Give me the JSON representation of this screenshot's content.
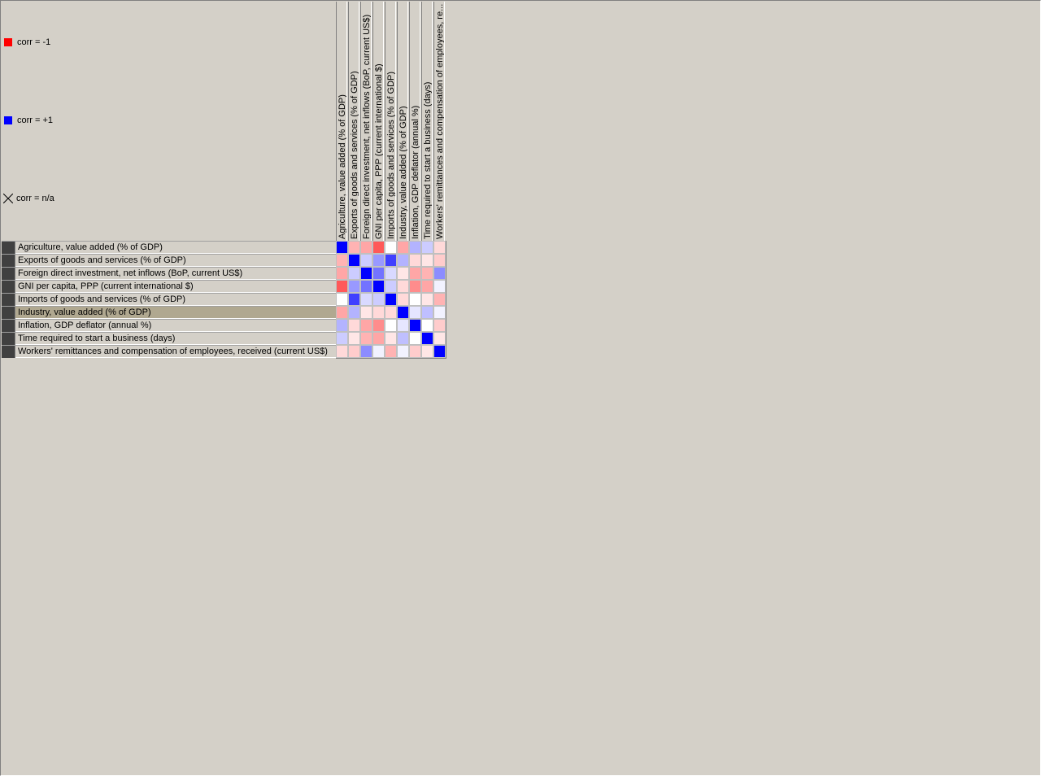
{
  "legend": [
    {
      "label": "corr = -1",
      "color": "#ff0000",
      "icon": "red-square-icon"
    },
    {
      "label": "corr = +1",
      "color": "#0000ff",
      "icon": "blue-square-icon"
    },
    {
      "label": "corr = n/a",
      "icon": "cross-icon"
    }
  ],
  "variables": [
    "Agriculture, value added (% of GDP)",
    "Exports of goods and services (% of GDP)",
    "Foreign direct investment, net inflows (BoP, current US$)",
    "GNI per capita, PPP (current international $)",
    "Imports of goods and services (% of GDP)",
    "Industry, value added (% of GDP)",
    "Inflation, GDP deflator (annual %)",
    "Time required to start a business (days)",
    "Workers' remittances and compensation of employees, received (current US$)"
  ],
  "column_headers": [
    "Agriculture, value added (% of GDP)",
    "Exports of goods and services (% of GDP)",
    "Foreign direct investment, net inflows (BoP, current US$)",
    "GNI per capita, PPP (current international $)",
    "Imports of goods and services (% of GDP)",
    "Industry, value added (% of GDP)",
    "Inflation, GDP deflator (annual %)",
    "Time required to start a business (days)",
    "Workers' remittances and compensation of employees, re..."
  ],
  "selected_row": 5,
  "colors": {
    "negative": "#ff0000",
    "positive": "#0000ff",
    "neutral": "#ffffff"
  },
  "chart_data": {
    "type": "heatmap",
    "x": [
      "Agriculture, value added (% of GDP)",
      "Exports of goods and services (% of GDP)",
      "Foreign direct investment, net inflows (BoP, current US$)",
      "GNI per capita, PPP (current international $)",
      "Imports of goods and services (% of GDP)",
      "Industry, value added (% of GDP)",
      "Inflation, GDP deflator (annual %)",
      "Time required to start a business (days)",
      "Workers' remittances and compensation of employees, received (current US$)"
    ],
    "y": [
      "Agriculture, value added (% of GDP)",
      "Exports of goods and services (% of GDP)",
      "Foreign direct investment, net inflows (BoP, current US$)",
      "GNI per capita, PPP (current international $)",
      "Imports of goods and services (% of GDP)",
      "Industry, value added (% of GDP)",
      "Inflation, GDP deflator (annual %)",
      "Time required to start a business (days)",
      "Workers' remittances and compensation of employees, received (current US$)"
    ],
    "values": [
      [
        1.0,
        -0.3,
        -0.35,
        -0.65,
        0.0,
        -0.35,
        0.3,
        0.2,
        -0.15
      ],
      [
        -0.3,
        1.0,
        0.2,
        0.4,
        0.75,
        0.3,
        -0.15,
        -0.1,
        -0.2
      ],
      [
        -0.35,
        0.2,
        1.0,
        0.55,
        0.15,
        -0.1,
        -0.35,
        -0.3,
        0.45
      ],
      [
        -0.65,
        0.4,
        0.55,
        1.0,
        0.2,
        -0.15,
        -0.45,
        -0.35,
        0.05
      ],
      [
        0.0,
        0.75,
        0.15,
        0.2,
        1.0,
        -0.15,
        0.0,
        -0.1,
        -0.3
      ],
      [
        -0.35,
        0.3,
        -0.1,
        -0.15,
        -0.15,
        1.0,
        0.1,
        0.25,
        0.05
      ],
      [
        0.3,
        -0.15,
        -0.35,
        -0.45,
        0.0,
        0.1,
        1.0,
        0.0,
        -0.2
      ],
      [
        0.2,
        -0.1,
        -0.3,
        -0.35,
        -0.1,
        0.25,
        0.0,
        1.0,
        -0.1
      ],
      [
        -0.15,
        -0.2,
        0.45,
        0.05,
        -0.3,
        0.05,
        -0.2,
        -0.1,
        1.0
      ]
    ],
    "zlim": [
      -1,
      1
    ]
  }
}
